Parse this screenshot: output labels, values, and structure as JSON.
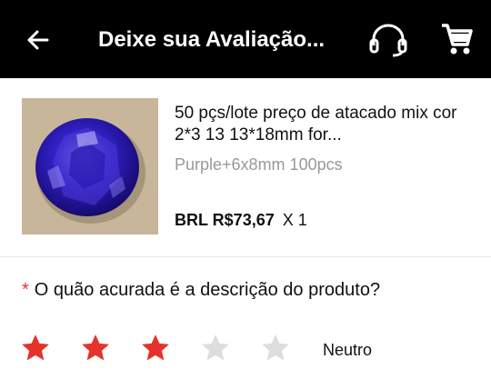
{
  "header": {
    "title": "Deixe sua Avaliação...",
    "back_icon": "arrow-left-icon",
    "support_icon": "headset-icon",
    "cart_icon": "shopping-cart-icon",
    "background": "#000000"
  },
  "product": {
    "name": "50 pçs/lote preço de atacado mix cor 2*3 13 13*18mm for...",
    "variant": "Purple+6x8mm 100pcs",
    "price": "BRL R$73,67",
    "quantity": "X 1",
    "image": "blue-oval-gemstone"
  },
  "question": {
    "required_mark": "*",
    "text": "O quão acurada é a descrição do produto?"
  },
  "rating": {
    "value": 3,
    "max": 5,
    "label": "Neutro",
    "active_color": "#e4332b",
    "inactive_color": "#dddddd"
  }
}
